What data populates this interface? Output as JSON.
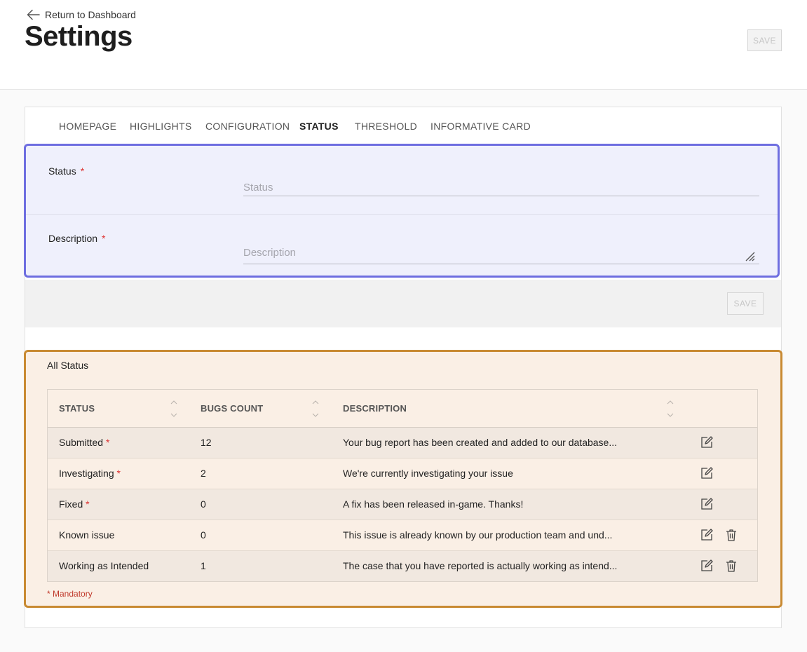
{
  "header": {
    "back_label": "Return to Dashboard",
    "title": "Settings",
    "save_label": "SAVE"
  },
  "tabs": [
    {
      "label": "HOMEPAGE",
      "active": false
    },
    {
      "label": "HIGHLIGHTS",
      "active": false
    },
    {
      "label": "CONFIGURATION",
      "active": false
    },
    {
      "label": "STATUS",
      "active": true
    },
    {
      "label": "THRESHOLD",
      "active": false
    },
    {
      "label": "INFORMATIVE CARD",
      "active": false
    }
  ],
  "form": {
    "status_label": "Status",
    "status_placeholder": "Status",
    "description_label": "Description",
    "description_placeholder": "Description",
    "required_marker": "*",
    "save_label": "SAVE"
  },
  "status_list": {
    "title": "All Status",
    "columns": [
      "STATUS",
      "BUGS COUNT",
      "DESCRIPTION"
    ],
    "rows": [
      {
        "status": "Submitted",
        "mandatory": "*",
        "bugs_count": "12",
        "description": "Your bug report has been created and added to our database...",
        "deletable": false
      },
      {
        "status": "Investigating",
        "mandatory": "*",
        "bugs_count": "2",
        "description": "We're currently investigating your issue",
        "deletable": false
      },
      {
        "status": "Fixed",
        "mandatory": "*",
        "bugs_count": "0",
        "description": "A fix has been released in-game. Thanks!",
        "deletable": false
      },
      {
        "status": "Known issue",
        "mandatory": "",
        "bugs_count": "0",
        "description": "This issue is already known by our production team and und...",
        "deletable": true
      },
      {
        "status": "Working as Intended",
        "mandatory": "",
        "bugs_count": "1",
        "description": "The case that you have reported is actually working as intend...",
        "deletable": true
      }
    ],
    "footnote": "* Mandatory"
  },
  "colors": {
    "form_highlight": "#6e6ee0",
    "list_highlight": "#c88a32",
    "required": "#d33333"
  },
  "icons": {
    "back": "arrow-left-icon",
    "sort": "sort-icon",
    "edit": "edit-icon",
    "delete": "trash-icon",
    "resize": "resize-handle-icon"
  }
}
